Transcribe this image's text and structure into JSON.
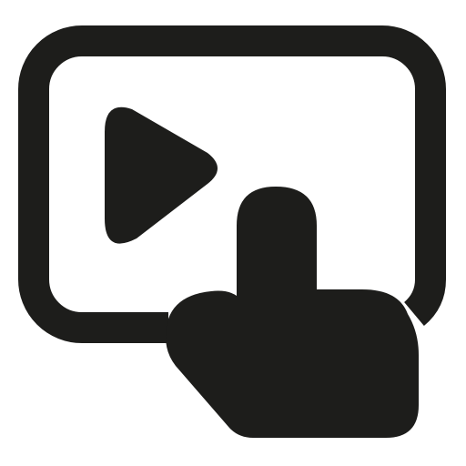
{
  "icon": {
    "name": "touch-play-video-icon",
    "color": "#1d1d1b",
    "background": "#ffffff"
  }
}
